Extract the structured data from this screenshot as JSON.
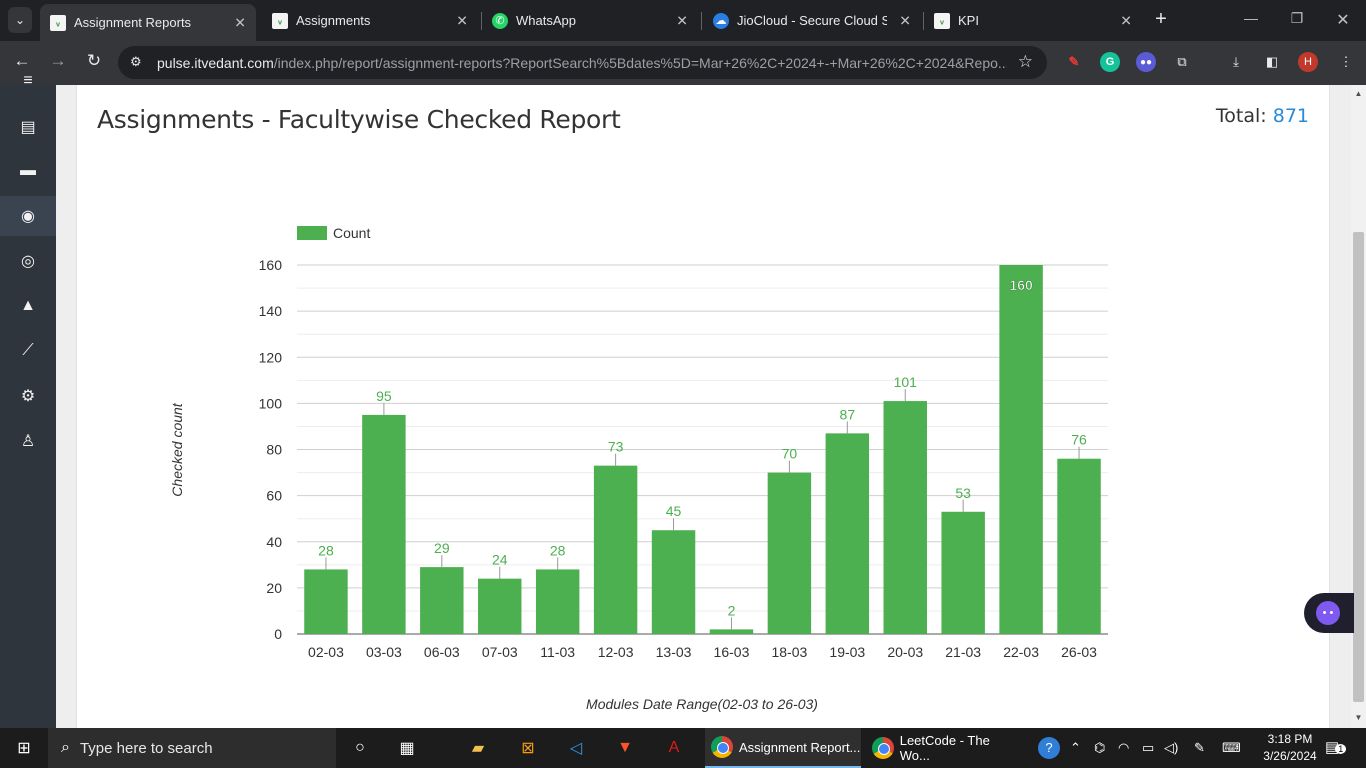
{
  "browser": {
    "tabs": [
      {
        "title": "Assignment Reports",
        "icon": "pulse-favicon",
        "active": true
      },
      {
        "title": "Assignments",
        "icon": "pulse-favicon",
        "active": false
      },
      {
        "title": "WhatsApp",
        "icon": "whatsapp-icon",
        "active": false
      },
      {
        "title": "JioCloud - Secure Cloud Sto",
        "icon": "jiocloud-icon",
        "active": false
      },
      {
        "title": "KPI",
        "icon": "pulse-favicon",
        "active": false
      }
    ],
    "url_host": "pulse.itvedant.com",
    "url_path": "/index.php/report/assignment-reports?ReportSearch%5Bdates%5D=Mar+26%2C+2024+-+Mar+26%2C+2024&Repo...",
    "profile_initial": "H"
  },
  "sidebar": {
    "items": [
      {
        "icon": "ticket-icon"
      },
      {
        "icon": "comment-icon"
      },
      {
        "icon": "target-icon",
        "active": true
      },
      {
        "icon": "target-icon"
      },
      {
        "icon": "graduation-cap-icon"
      },
      {
        "icon": "line-chart-icon"
      },
      {
        "icon": "cogs-icon"
      },
      {
        "icon": "sitemap-icon"
      }
    ]
  },
  "report": {
    "title": "Assignments - Facultywise Checked Report",
    "total_label": "Total:",
    "total_value": "871"
  },
  "chart_data": {
    "type": "bar",
    "categories": [
      "02-03",
      "03-03",
      "06-03",
      "07-03",
      "11-03",
      "12-03",
      "13-03",
      "16-03",
      "18-03",
      "19-03",
      "20-03",
      "21-03",
      "22-03",
      "26-03"
    ],
    "series": [
      {
        "name": "Count",
        "values": [
          28,
          95,
          29,
          24,
          28,
          73,
          45,
          2,
          70,
          87,
          101,
          53,
          160,
          76
        ],
        "color": "#4caf50"
      }
    ],
    "xlabel": "Modules Date Range(02-03 to 26-03)",
    "ylabel": "Checked count",
    "ylim": [
      0,
      160
    ],
    "yticks": [
      0,
      20,
      40,
      60,
      80,
      100,
      120,
      140,
      160
    ],
    "grid": true,
    "legend": "top-left",
    "label_color": "#4caf50"
  },
  "taskbar": {
    "search_placeholder": "Type here to search",
    "apps": [
      {
        "title": "Assignment Report...",
        "active": true
      },
      {
        "title": "LeetCode - The Wo...",
        "active": false
      }
    ],
    "time": "3:18 PM",
    "date": "3/26/2024",
    "notification_count": "1"
  }
}
